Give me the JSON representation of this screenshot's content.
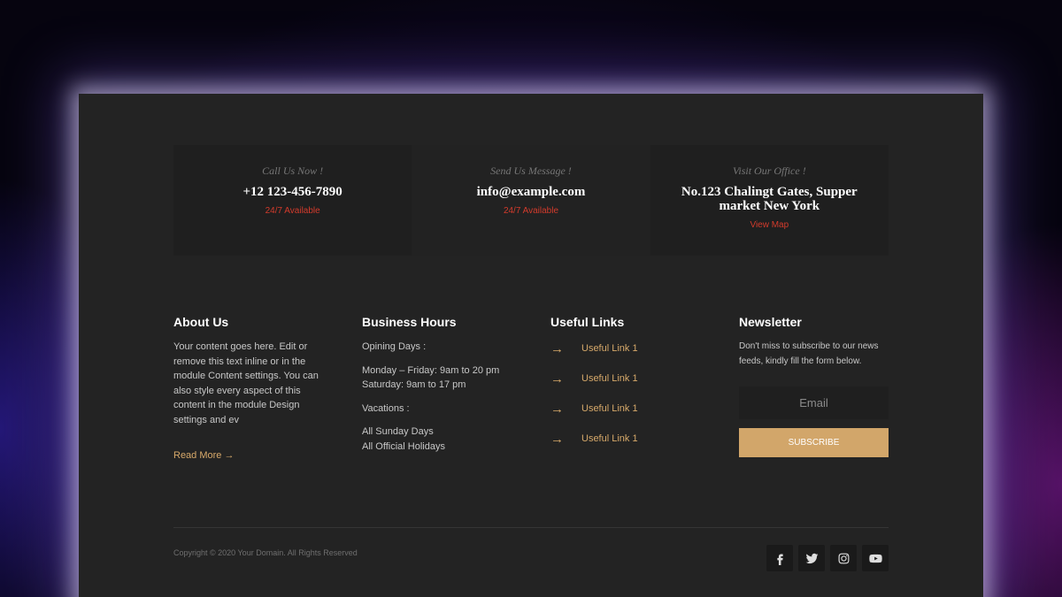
{
  "contacts": [
    {
      "eyebrow": "Call Us Now !",
      "main": "+12 123-456-7890",
      "sub": "24/7 Available"
    },
    {
      "eyebrow": "Send Us Message !",
      "main": "info@example.com",
      "sub": "24/7 Available"
    },
    {
      "eyebrow": "Visit Our Office !",
      "main": "No.123 Chalingt Gates, Supper market New York",
      "sub": "View Map"
    }
  ],
  "about": {
    "title": "About Us",
    "text": "Your content goes here. Edit or remove this text inline or in the module Content settings. You can also style every aspect of this content in the module Design settings and ev",
    "read_more": "Read More →"
  },
  "hours": {
    "title": "Business Hours",
    "lines": [
      "Opining Days :",
      "Monday – Friday: 9am to 20 pm",
      "Saturday: 9am to 17 pm",
      "Vacations :",
      "All Sunday Days",
      "All Official Holidays"
    ]
  },
  "links": {
    "title": "Useful Links",
    "items": [
      {
        "arrow": "→",
        "label": "Useful Link 1"
      },
      {
        "arrow": "→",
        "label": "Useful Link 1"
      },
      {
        "arrow": "→",
        "label": "Useful Link 1"
      },
      {
        "arrow": "→",
        "label": "Useful Link 1"
      }
    ]
  },
  "newsletter": {
    "title": "Newsletter",
    "text": "Don't miss to subscribe to our news feeds, kindly fill the form below.",
    "email_placeholder": "Email",
    "button_label": "SUBSCRIBE"
  },
  "footer": {
    "copyright": "Copyright © 2020 Your Domain. All Rights Reserved"
  },
  "socials": [
    "facebook-icon",
    "twitter-icon",
    "instagram-icon",
    "youtube-icon"
  ],
  "colors": {
    "accent": "#d7a96a",
    "button": "#d2a66a",
    "alert": "#d33b2c",
    "panel": "#232323"
  }
}
